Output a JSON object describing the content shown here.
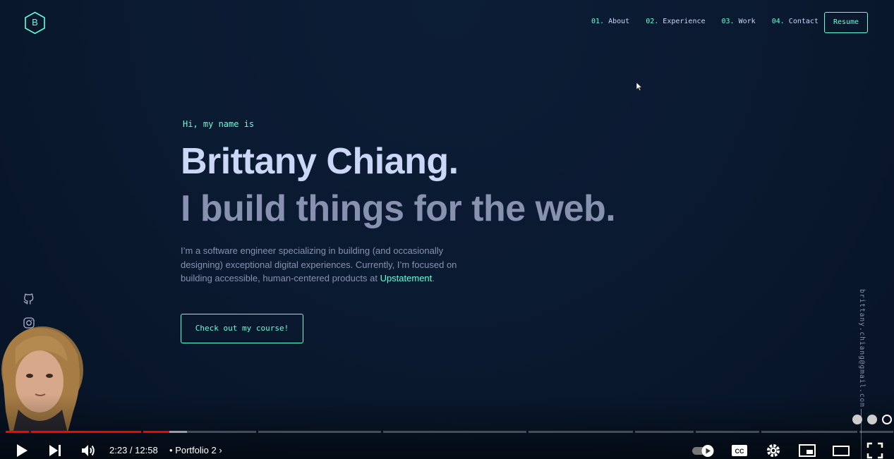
{
  "header": {
    "logo_letter": "B",
    "nav": [
      {
        "num": "01.",
        "label": "About"
      },
      {
        "num": "02.",
        "label": "Experience"
      },
      {
        "num": "03.",
        "label": "Work"
      },
      {
        "num": "04.",
        "label": "Contact"
      }
    ],
    "resume_label": "Resume"
  },
  "hero": {
    "greeting": "Hi, my name is",
    "name": "Brittany Chiang.",
    "tagline": "I build things for the web.",
    "intro_prefix": "I’m a software engineer specializing in building (and occasionally designing) exceptional digital experiences. Currently, I’m focused on building accessible, human-centered products at ",
    "intro_link": "Upstatement",
    "intro_suffix": ".",
    "cta_label": "Check out my course!"
  },
  "side": {
    "social_icons": [
      "github-icon",
      "instagram-icon"
    ],
    "email": "brittany.chiang@gmail.com"
  },
  "player": {
    "time": "2:23 / 12:58",
    "separator": "•",
    "chapter": "Portfolio 2",
    "played_fraction": 0.184,
    "icons": [
      "play-icon",
      "next-icon",
      "volume-icon",
      "autoplay-toggle-icon",
      "captions-icon",
      "settings-icon",
      "miniplayer-icon",
      "theater-icon",
      "fullscreen-icon"
    ]
  },
  "colors": {
    "background": "#0a192f",
    "accent": "#64ffda",
    "heading": "#ccd6f6",
    "body": "#8892b0",
    "progress_played": "#ff0000"
  }
}
